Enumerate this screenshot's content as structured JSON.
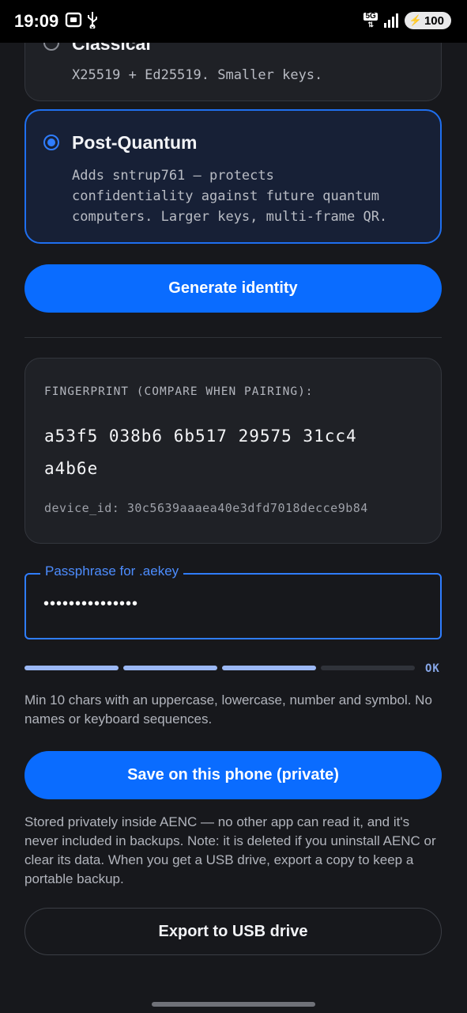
{
  "status_bar": {
    "time": "19:09",
    "network": "5G",
    "battery": "100"
  },
  "options": [
    {
      "title": "Classical",
      "desc": "X25519 + Ed25519. Smaller keys.",
      "selected": false
    },
    {
      "title": "Post-Quantum",
      "desc": "Adds sntrup761 — protects\nconfidentiality against future quantum\ncomputers. Larger keys, multi-frame QR.",
      "selected": true
    }
  ],
  "generate_button": "Generate identity",
  "fingerprint": {
    "label": "FINGERPRINT (COMPARE WHEN PAIRING):",
    "value": "a53f5 038b6 6b517 29575 31cc4 a4b6e",
    "device_id": "device_id: 30c5639aaaea40e3dfd7018decce9b84"
  },
  "passphrase": {
    "label": "Passphrase for .aekey",
    "value": "•••••••••••••••"
  },
  "strength": {
    "label": "OK",
    "level": 0.75
  },
  "passphrase_hint": "Min 10 chars with an uppercase, lowercase, number and symbol. No names or keyboard sequences.",
  "save_button": "Save on this phone (private)",
  "storage_note": "Stored privately inside AENC — no other app can read it, and it's never included in backups. Note: it is deleted if you uninstall AENC or clear its data. When you get a USB drive, export a copy to keep a portable backup.",
  "export_button": "Export to USB drive",
  "colors": {
    "accent": "#0a6cff",
    "background": "#17181c",
    "selected_border": "#1f6fef"
  }
}
